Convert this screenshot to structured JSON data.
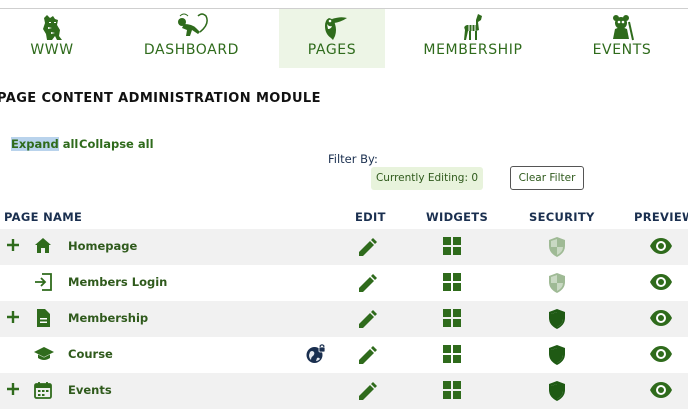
{
  "nav": {
    "items": [
      {
        "label": "WWW",
        "icon": "tiger-icon",
        "active": false
      },
      {
        "label": "DASHBOARD",
        "icon": "monkey-icon",
        "active": false
      },
      {
        "label": "PAGES",
        "icon": "toucan-icon",
        "active": true
      },
      {
        "label": "MEMBERSHIP",
        "icon": "zebra-icon",
        "active": false
      },
      {
        "label": "EVENTS",
        "icon": "panda-icon",
        "active": false
      }
    ]
  },
  "page": {
    "title": "PAGE CONTENT ADMINISTRATION MODULE",
    "expand_all_highlight": "Expand",
    "expand_all_rest": " all",
    "collapse_all": "Collapse all",
    "filter_by": "Filter By:",
    "currently_editing": "Currently Editing: 0",
    "clear_filter": "Clear Filter"
  },
  "table": {
    "headers": {
      "page_name": "PAGE NAME",
      "edit": "EDIT",
      "widgets": "WIDGETS",
      "security": "SECURITY",
      "preview": "PREVIEW"
    },
    "rows": [
      {
        "name": "Homepage",
        "icon": "home-icon",
        "expandable": true,
        "security": "shield-unlocked-icon"
      },
      {
        "name": "Members Login",
        "icon": "login-icon",
        "expandable": false,
        "security": "shield-unlocked-icon"
      },
      {
        "name": "Membership",
        "icon": "document-icon",
        "expandable": true,
        "security": "shield-locked-icon"
      },
      {
        "name": "Course",
        "icon": "graduation-cap-icon",
        "expandable": false,
        "security": "shield-locked-icon",
        "globe": "public-lock-icon"
      },
      {
        "name": "Events",
        "icon": "calendar-icon",
        "expandable": true,
        "security": "shield-locked-icon"
      }
    ]
  },
  "colors": {
    "brand_green": "#2f6b1c",
    "header_navy": "#1a2f4f",
    "active_tab_bg": "#edf5e6",
    "row_shade": "#f1f1f1"
  }
}
